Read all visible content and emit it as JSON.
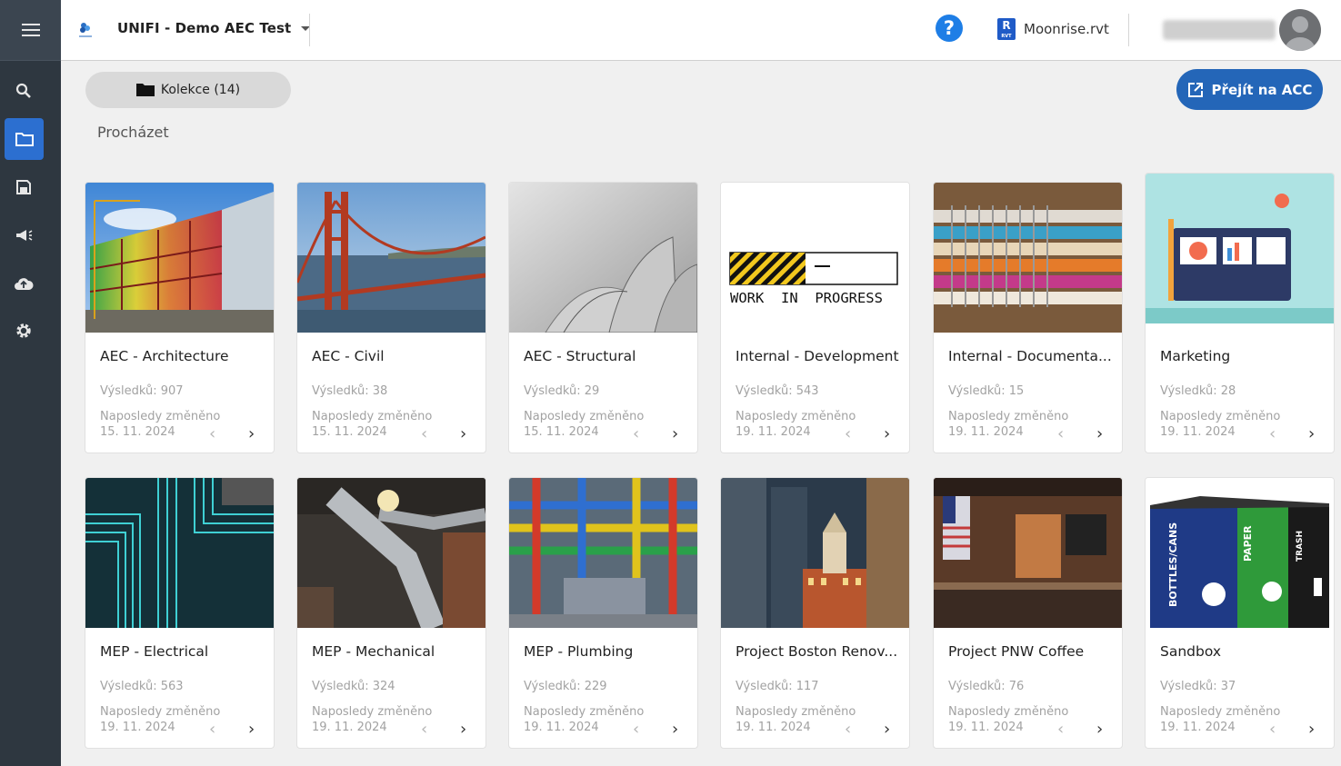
{
  "header": {
    "project_name": "UNIFI - Demo AEC Test",
    "help_label": "?",
    "revit_badge": "R",
    "revit_sub": "RVT",
    "file_name": "Moonrise.rvt"
  },
  "toolbar": {
    "collection_label": "Kolekce (14)",
    "go_acc_label": "Přejít na ACC",
    "browse_label": "Procházet"
  },
  "colors": {
    "sidebar": "#2e3740",
    "active_nav": "#2c6fd0",
    "primary_button": "#2466b8",
    "help": "#1e7ee6"
  },
  "sidebar": {
    "items": [
      {
        "icon": "menu-icon"
      },
      {
        "icon": "search-icon"
      },
      {
        "icon": "folder-icon",
        "active": true
      },
      {
        "icon": "save-icon"
      },
      {
        "icon": "megaphone-icon"
      },
      {
        "icon": "cloud-upload-icon"
      },
      {
        "icon": "gear-icon"
      }
    ]
  },
  "cards": [
    {
      "title": "AEC - Architecture",
      "count": "Výsledků: 907",
      "modified_label": "Naposledy změněno",
      "date": "15. 11. 2024"
    },
    {
      "title": "AEC - Civil",
      "count": "Výsledků: 38",
      "modified_label": "Naposledy změněno",
      "date": "15. 11. 2024"
    },
    {
      "title": "AEC - Structural",
      "count": "Výsledků: 29",
      "modified_label": "Naposledy změněno",
      "date": "15. 11. 2024"
    },
    {
      "title": "Internal - Development",
      "count": "Výsledků: 543",
      "modified_label": "Naposledy změněno",
      "date": "19. 11. 2024",
      "image_text": "WORK  IN  PROGRESS"
    },
    {
      "title": "Internal - Documenta...",
      "count": "Výsledků: 15",
      "modified_label": "Naposledy změněno",
      "date": "19. 11. 2024"
    },
    {
      "title": "Marketing",
      "count": "Výsledků: 28",
      "modified_label": "Naposledy změněno",
      "date": "19. 11. 2024"
    },
    {
      "title": "MEP - Electrical",
      "count": "Výsledků: 563",
      "modified_label": "Naposledy změněno",
      "date": "19. 11. 2024"
    },
    {
      "title": "MEP - Mechanical",
      "count": "Výsledků: 324",
      "modified_label": "Naposledy změněno",
      "date": "19. 11. 2024"
    },
    {
      "title": "MEP - Plumbing",
      "count": "Výsledků: 229",
      "modified_label": "Naposledy změněno",
      "date": "19. 11. 2024"
    },
    {
      "title": "Project Boston Renov...",
      "count": "Výsledků: 117",
      "modified_label": "Naposledy změněno",
      "date": "19. 11. 2024"
    },
    {
      "title": "Project PNW Coffee",
      "count": "Výsledků: 76",
      "modified_label": "Naposledy změněno",
      "date": "19. 11. 2024"
    },
    {
      "title": "Sandbox",
      "count": "Výsledků: 37",
      "modified_label": "Naposledy změněno",
      "date": "19. 11. 2024",
      "bin_labels": [
        "BOTTLES/CANS",
        "PAPER",
        "TRASH"
      ]
    }
  ]
}
